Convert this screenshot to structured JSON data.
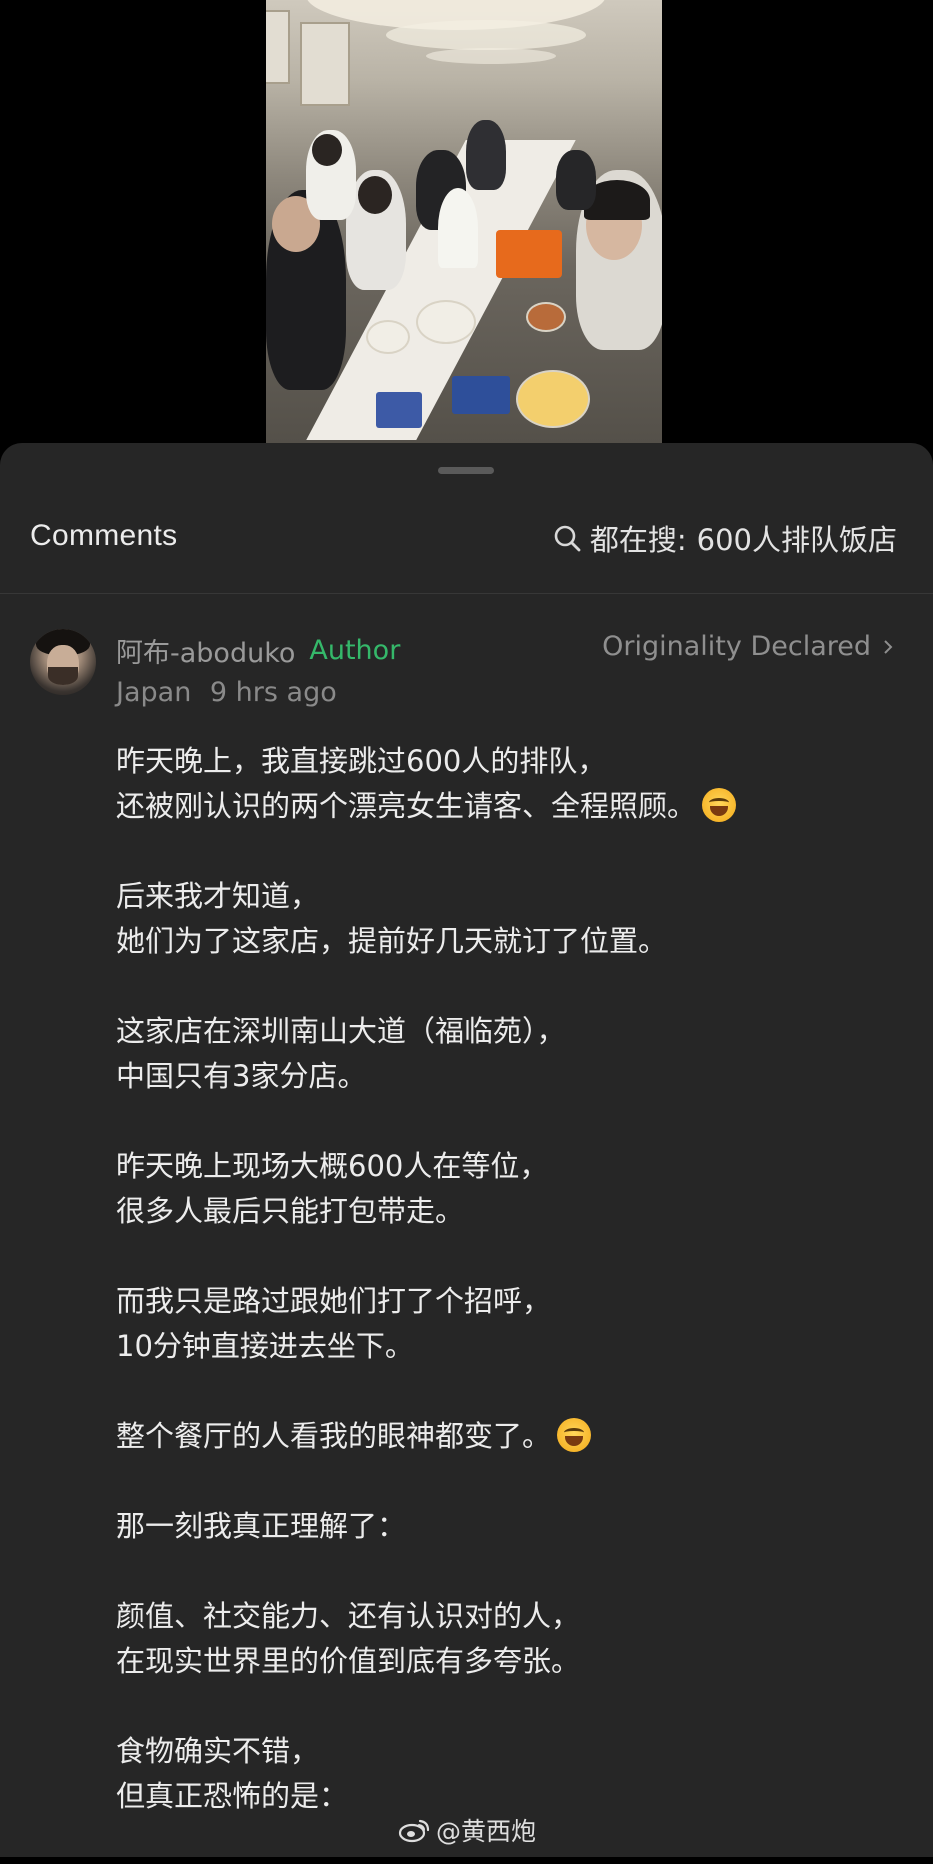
{
  "header": {
    "title": "Comments",
    "search_prefix": "都在搜:",
    "search_term": "600人排队饭店"
  },
  "comment": {
    "author": "阿布-aboduko",
    "author_tag": "Author",
    "originality": "Originality Declared",
    "location": "Japan",
    "time": "9 hrs ago",
    "paragraphs": [
      [
        "昨天晚上，我直接跳过600人的排队，",
        "还被刚认识的两个漂亮女生请客、全程照顾。"
      ],
      [
        "后来我才知道，",
        "她们为了这家店，提前好几天就订了位置。"
      ],
      [
        "这家店在深圳南山大道（福临苑），",
        "中国只有3家分店。"
      ],
      [
        "昨天晚上现场大概600人在等位，",
        "很多人最后只能打包带走。"
      ],
      [
        "而我只是路过跟她们打了个招呼，",
        "10分钟直接进去坐下。"
      ],
      [
        "整个餐厅的人看我的眼神都变了。"
      ],
      [
        "那一刻我真正理解了："
      ],
      [
        "颜值、社交能力、还有认识对的人，",
        "在现实世界里的价值到底有多夸张。"
      ],
      [
        "食物确实不错，",
        "但真正恐怖的是："
      ]
    ]
  },
  "watermark": "@黄西炮",
  "icons": {
    "search": "search-icon",
    "chevron": "chevron-right-icon",
    "emoji": "tears-of-joy-emoji-icon",
    "weibo": "weibo-logo-icon"
  },
  "colors": {
    "sheet_bg": "#262626",
    "author_tag": "#35b86a",
    "text": "#ececec",
    "muted": "#8a8a8a"
  }
}
